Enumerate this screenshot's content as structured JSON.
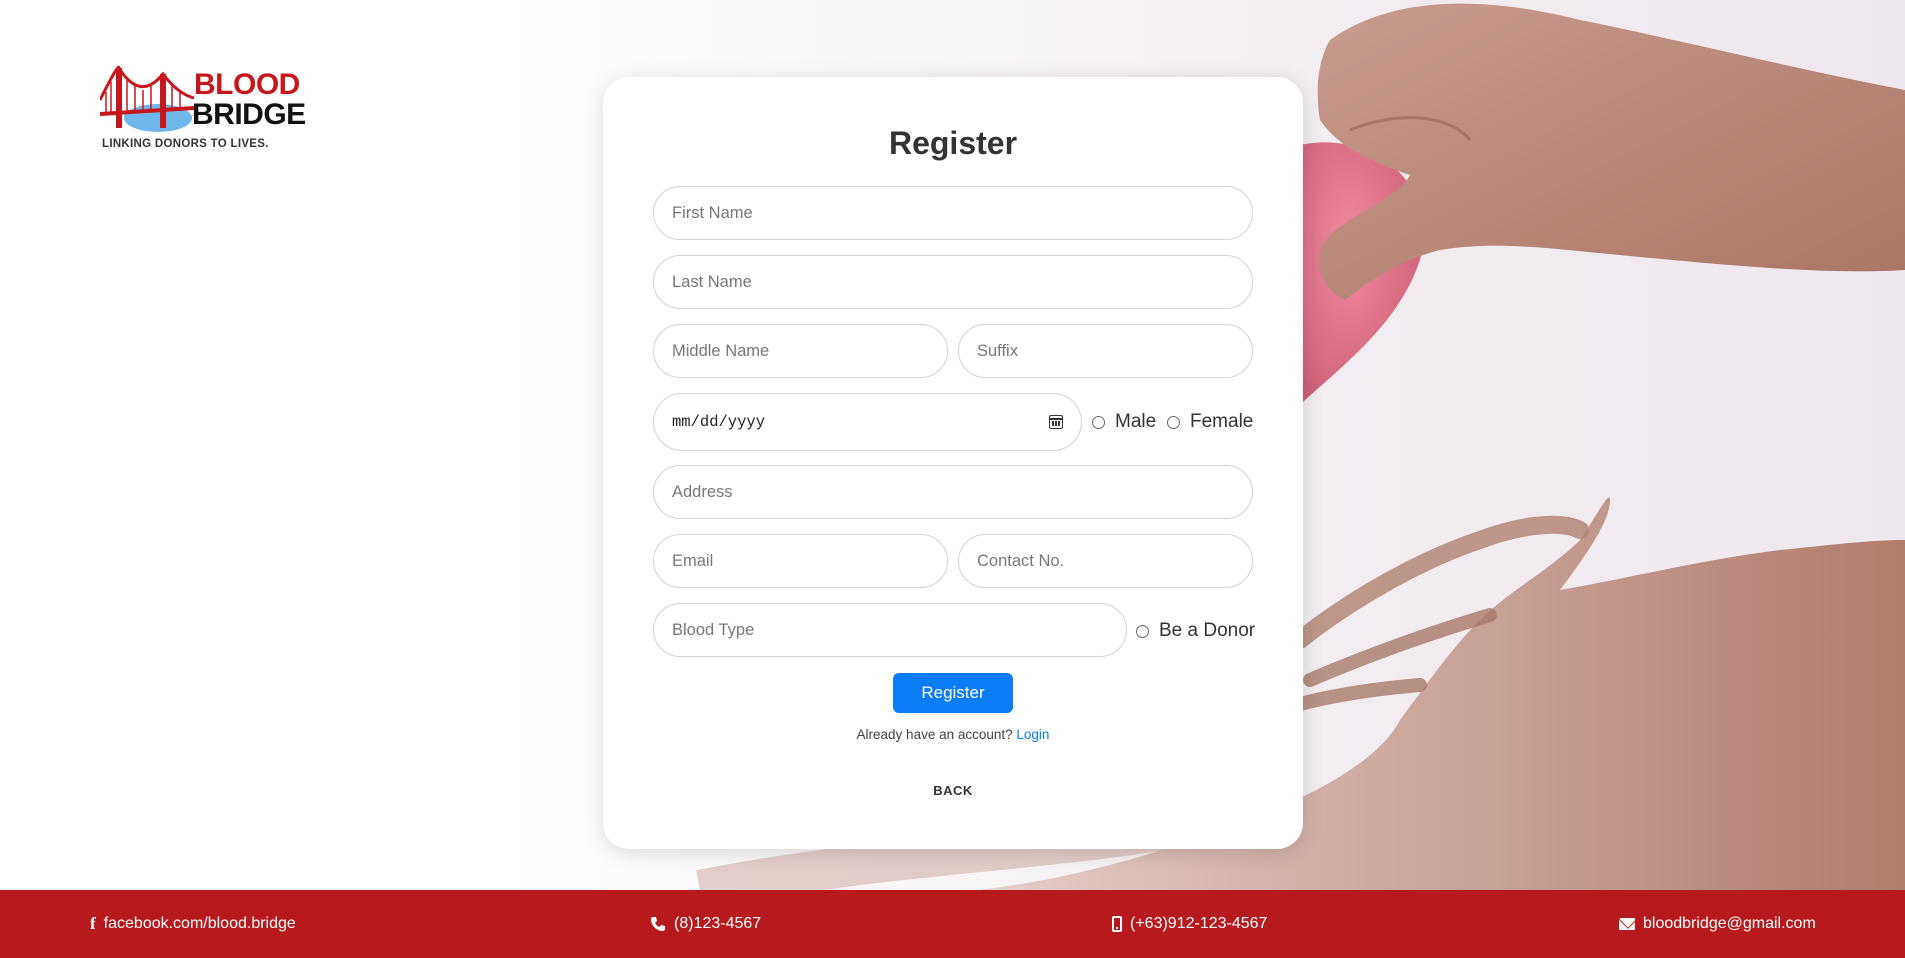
{
  "logo": {
    "word1": "BLOOD",
    "word2": "BRIDGE",
    "tagline": "LINKING DONORS TO LIVES."
  },
  "form": {
    "title": "Register",
    "first_name_placeholder": "First Name",
    "last_name_placeholder": "Last Name",
    "middle_name_placeholder": "Middle Name",
    "suffix_placeholder": "Suffix",
    "birthdate_value": "mm/dd/yyyy",
    "gender_options": [
      "Male",
      "Female"
    ],
    "address_placeholder": "Address",
    "email_placeholder": "Email",
    "contact_placeholder": "Contact No.",
    "blood_type_placeholder": "Blood Type",
    "donor_label": "Be a Donor",
    "submit_label": "Register",
    "account_prompt": "Already have an account?",
    "login_link": "Login",
    "back_label": "BACK"
  },
  "footer": {
    "facebook": "facebook.com/blood.bridge",
    "phone": "(8)123-4567",
    "mobile": "(+63)912-123-4567",
    "email": "bloodbridge@gmail.com"
  },
  "colors": {
    "brand_red": "#b71a1c",
    "accent_blue": "#0a7cf5"
  }
}
